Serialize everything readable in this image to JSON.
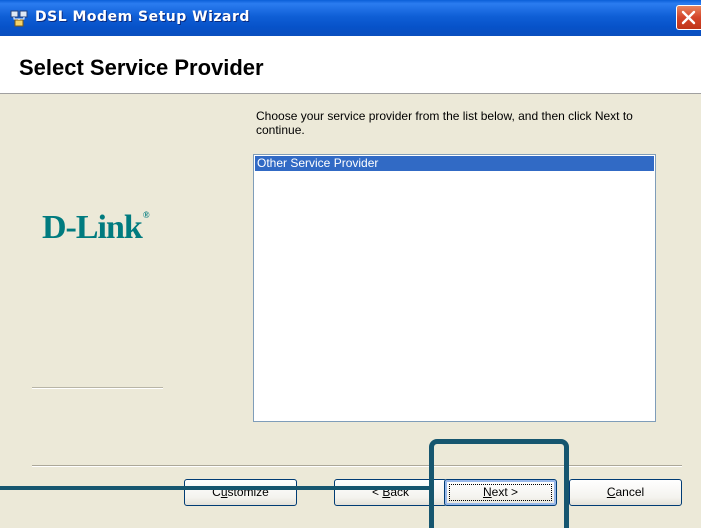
{
  "window": {
    "title": "DSL Modem Setup Wizard",
    "icon": "network-wizard-icon",
    "close_icon": "close-icon"
  },
  "header": {
    "title": "Select Service Provider"
  },
  "sidebar": {
    "logo_text": "D-Link",
    "logo_mark": "®"
  },
  "main": {
    "instructions": "Choose your service provider from the list below, and then click Next to continue.",
    "providers": [
      "Other Service Provider"
    ],
    "selected_index": 0
  },
  "buttons": {
    "customize": {
      "pre": "C",
      "key": "u",
      "post": "stomize"
    },
    "back": {
      "pre": "< ",
      "key": "B",
      "post": "ack"
    },
    "next": {
      "pre": "",
      "key": "N",
      "post": "ext >"
    },
    "cancel": {
      "pre": "",
      "key": "C",
      "post": "ancel"
    }
  },
  "colors": {
    "titlebar": "#0a5fd8",
    "selection": "#316ac5",
    "logo": "#007b7f",
    "callout": "#16566f",
    "dialog_bg": "#ece9d8"
  }
}
